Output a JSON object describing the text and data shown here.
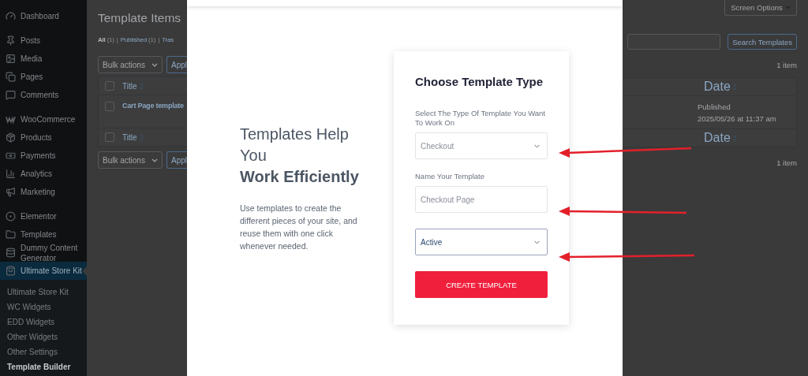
{
  "sidebar": {
    "items": [
      {
        "label": "Dashboard",
        "selected": false
      },
      {
        "label": "Posts",
        "selected": false
      },
      {
        "label": "Media",
        "selected": false
      },
      {
        "label": "Pages",
        "selected": false
      },
      {
        "label": "Comments",
        "selected": false
      },
      {
        "label": "WooCommerce",
        "selected": false
      },
      {
        "label": "Products",
        "selected": false
      },
      {
        "label": "Payments",
        "selected": false
      },
      {
        "label": "Analytics",
        "selected": false
      },
      {
        "label": "Marketing",
        "selected": false
      },
      {
        "label": "Elementor",
        "selected": false
      },
      {
        "label": "Templates",
        "selected": false
      },
      {
        "label": "Dummy Content Generator",
        "selected": false
      },
      {
        "label": "Ultimate Store Kit",
        "selected": true
      }
    ],
    "submenu": [
      {
        "label": "Ultimate Store Kit",
        "selected": false
      },
      {
        "label": "WC Widgets",
        "selected": false
      },
      {
        "label": "EDD Widgets",
        "selected": false
      },
      {
        "label": "Other Widgets",
        "selected": false
      },
      {
        "label": "Other Settings",
        "selected": false
      },
      {
        "label": "Template Builder",
        "selected": true
      }
    ]
  },
  "page": {
    "title": "Template Items",
    "filters": [
      {
        "label": "All",
        "count": "(1)",
        "selected": true
      },
      {
        "label": "Published",
        "count": "(1)",
        "selected": false
      },
      {
        "label": "Tras",
        "selected": false
      }
    ],
    "divider": "|",
    "bulk_top": {
      "select": "Bulk actions",
      "apply": "Appl"
    },
    "table_header": {
      "title": "Title",
      "date": "Date",
      "checked": false
    },
    "rows": [
      {
        "title": "Cart Page template",
        "status": "Published",
        "date": "2025/05/26 at 11:37 am",
        "checked": false
      }
    ],
    "table_footer": {
      "title": "Title",
      "date": "Date",
      "checked": false
    },
    "bulk_bottom": {
      "select": "Bulk actions",
      "apply": "Appl"
    },
    "screen_options": "Screen Options",
    "search_button": "Search Templates",
    "count_top": "1 item",
    "count_bottom": "1 item"
  },
  "modal": {
    "intro": {
      "heading": "Templates Help You",
      "heading_bold": "Work Efficiently",
      "text": "Use templates to create the different pieces of your site, and reuse them with one click whenever needed."
    },
    "card": {
      "title": "Choose Template Type",
      "fields": [
        {
          "kind": "select",
          "label": "Select The Type Of Template You Want To Work On",
          "value": "Checkout",
          "focused": false
        },
        {
          "kind": "input",
          "label": "Name Your Template",
          "placeholder": "Checkout Page"
        },
        {
          "kind": "select",
          "value": "Active",
          "focused": true
        }
      ],
      "button": "CREATE TEMPLATE"
    }
  }
}
